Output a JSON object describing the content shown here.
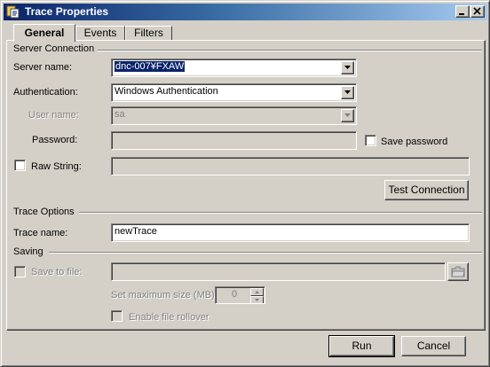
{
  "window": {
    "title": "Trace Properties"
  },
  "tabs": [
    {
      "label": "General",
      "active": true
    },
    {
      "label": "Events",
      "active": false
    },
    {
      "label": "Filters",
      "active": false
    }
  ],
  "server_connection": {
    "section_label": "Server Connection",
    "server_name": {
      "label": "Server name:",
      "value": "dnc-007¥FXAW"
    },
    "authentication": {
      "label": "Authentication:",
      "value": "Windows Authentication"
    },
    "user_name": {
      "label": "User name:",
      "value": "sa"
    },
    "password": {
      "label": "Password:",
      "value": ""
    },
    "save_password": {
      "label": "Save password",
      "checked": false
    },
    "raw_string": {
      "label": "Raw String:",
      "checked": false,
      "value": ""
    },
    "test_connection_label": "Test Connection"
  },
  "trace_options": {
    "section_label": "Trace Options",
    "trace_name": {
      "label": "Trace name:",
      "value": "newTrace"
    }
  },
  "saving": {
    "section_label": "Saving",
    "save_to_file": {
      "label": "Save to file:",
      "checked": false,
      "value": ""
    },
    "max_size": {
      "label": "Set maximum size (MB)",
      "value": "0"
    },
    "file_rollover": {
      "label": "Enable file rollover",
      "checked": false
    }
  },
  "footer": {
    "run_label": "Run",
    "cancel_label": "Cancel"
  },
  "colors": {
    "title_start": "#0a246a",
    "title_end": "#a6caf0",
    "face": "#d4d0c8"
  }
}
